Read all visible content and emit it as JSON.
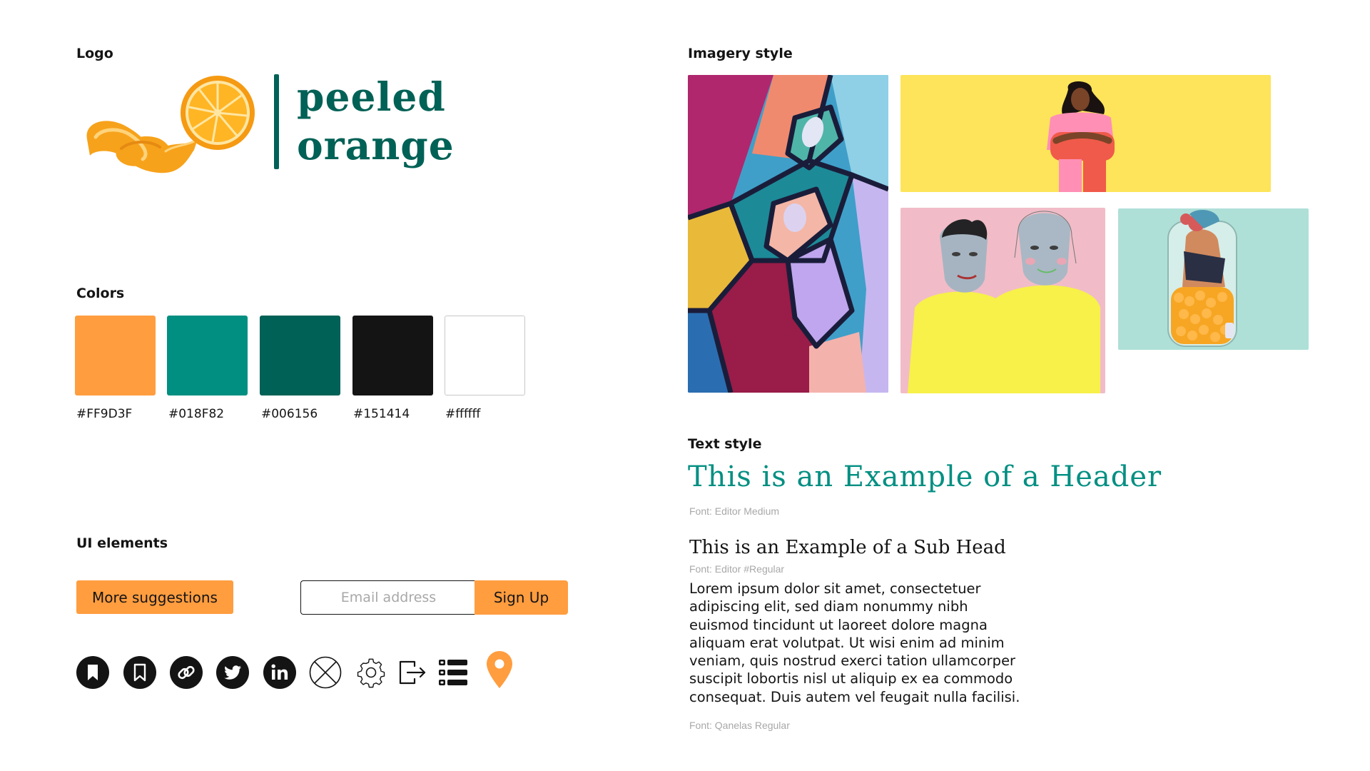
{
  "sections": {
    "logo": "Logo",
    "colors": "Colors",
    "ui_elements": "UI elements",
    "imagery": "Imagery style",
    "text_style": "Text style"
  },
  "logo": {
    "word1": "peeled",
    "word2": "orange"
  },
  "colors": [
    {
      "hex": "#FF9D3F",
      "label": "#FF9D3F"
    },
    {
      "hex": "#018F82",
      "label": "#018F82"
    },
    {
      "hex": "#006156",
      "label": "#006156"
    },
    {
      "hex": "#151414",
      "label": "#151414"
    },
    {
      "hex": "#ffffff",
      "label": "#ffffff"
    }
  ],
  "ui": {
    "more_button": "More suggestions",
    "email_placeholder": "Email address",
    "signup_button": "Sign Up",
    "icons": [
      "bookmark-filled-icon",
      "bookmark-outline-icon",
      "link-icon",
      "twitter-icon",
      "linkedin-icon",
      "close-circle-icon",
      "gear-icon",
      "logout-icon",
      "list-icon",
      "location-pin-icon"
    ]
  },
  "text_style": {
    "header": "This is an Example of a Header",
    "header_font": "Font: Editor Medium",
    "subhead": "This is an Example of a Sub Head",
    "subhead_font": "Font: Editor #Regular",
    "body": "Lorem ipsum dolor sit amet, consectetuer adipiscing elit, sed diam nonummy nibh euismod tincidunt ut laoreet dolore magna aliquam erat volutpat. Ut wisi enim ad minim veniam, quis nostrud exerci tation ullamcorper suscipit lobortis nisl ut aliquip ex ea commodo consequat. Duis autem vel feugait nulla facilisi.",
    "body_font": "Font: Qanelas Regular"
  },
  "palette": {
    "orange": "#FF9D3F",
    "teal": "#018F82",
    "dark_teal": "#006156",
    "black": "#151414",
    "white": "#ffffff"
  }
}
